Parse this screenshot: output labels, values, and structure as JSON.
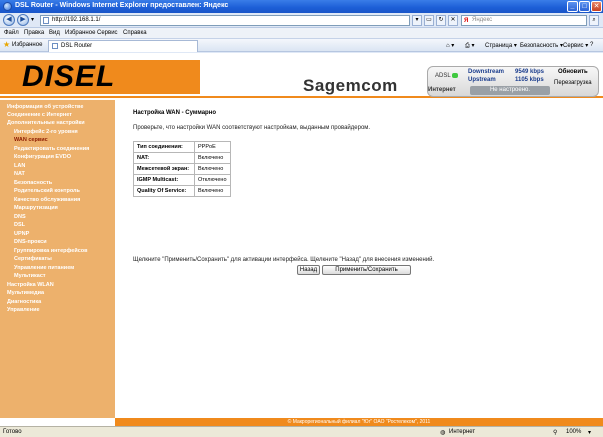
{
  "window": {
    "title": "DSL Router - Windows Internet Explorer предоставлен: Яндекс",
    "min": "_",
    "max": "□",
    "close": "✕"
  },
  "address": {
    "url": "http://192.168.1.1/",
    "search_placeholder": "Яндекс"
  },
  "menu": [
    "Файл",
    "Правка",
    "Вид",
    "Избранное",
    "Сервис",
    "Справка"
  ],
  "favorites": {
    "label": "Избранное",
    "tab": "DSL Router"
  },
  "tools": {
    "page": "Страница ▾",
    "security": "Безопасность ▾",
    "service": "Сервис ▾",
    "help": "?"
  },
  "header": {
    "logo": "DISEL",
    "brand": "Sagemcom",
    "adsl": "ADSL",
    "downstream_label": "Downstream",
    "upstream_label": "Upstream",
    "downstream_value": "9549 kbps",
    "upstream_value": "1105 kbps",
    "refresh": "Обновить",
    "reboot": "Перезагрузка",
    "internet": "Интернет",
    "internet_status": "Не настроено."
  },
  "sidebar": {
    "items": [
      {
        "label": "Информация об устройстве",
        "level": 0
      },
      {
        "label": "Соединение с Интернет",
        "level": 0
      },
      {
        "label": "Дополнительные настройки",
        "level": 0
      },
      {
        "label": "Интерфейс 2-го уровня",
        "level": 1
      },
      {
        "label": "WAN сервис",
        "level": 1,
        "active": true
      },
      {
        "label": "Редактировать соединения",
        "level": 1
      },
      {
        "label": "Конфигурация EVDO",
        "level": 1
      },
      {
        "label": "LAN",
        "level": 1
      },
      {
        "label": "NAT",
        "level": 1
      },
      {
        "label": "Безопасность",
        "level": 1
      },
      {
        "label": "Родительский контроль",
        "level": 1
      },
      {
        "label": "Качество обслуживания",
        "level": 1
      },
      {
        "label": "Маршрутизация",
        "level": 1
      },
      {
        "label": "DNS",
        "level": 1
      },
      {
        "label": "DSL",
        "level": 1
      },
      {
        "label": "UPNP",
        "level": 1
      },
      {
        "label": "DNS-прокси",
        "level": 1
      },
      {
        "label": "Группировка интерфейсов",
        "level": 1
      },
      {
        "label": "Сертификаты",
        "level": 1
      },
      {
        "label": "Управление питанием",
        "level": 1
      },
      {
        "label": "Мультикаст",
        "level": 1
      },
      {
        "label": "Настройка WLAN",
        "level": 0
      },
      {
        "label": "Мультимедиа",
        "level": 0
      },
      {
        "label": "Диагностика",
        "level": 0
      },
      {
        "label": "Управление",
        "level": 0
      }
    ]
  },
  "main": {
    "title": "Настройка WAN - Суммарно",
    "description": "Проверьте, что настройки WAN соответствуют настройкам, выданным провайдером.",
    "rows": [
      {
        "key": "Тип соединения:",
        "value": "PPPoE"
      },
      {
        "key": "NAT:",
        "value": "Включено"
      },
      {
        "key": "Межсетевой экран:",
        "value": "Включено"
      },
      {
        "key": "IGMP Multicast:",
        "value": "Отключено"
      },
      {
        "key": "Quality Of Service:",
        "value": "Включено"
      }
    ],
    "hint": "Щелкните \"Применить/Сохранить\" для активации интерфейса. Щелкните \"Назад\" для внесения изменений.",
    "back_button": "Назад",
    "apply_button": "Применить/Сохранить"
  },
  "footer": "© Макрорегиональный филиал \"Юг\" ОАО \"Ростелеком\", 2011",
  "statusbar": {
    "left": "Готово",
    "zone": "Интернет",
    "zoom": "100%"
  }
}
